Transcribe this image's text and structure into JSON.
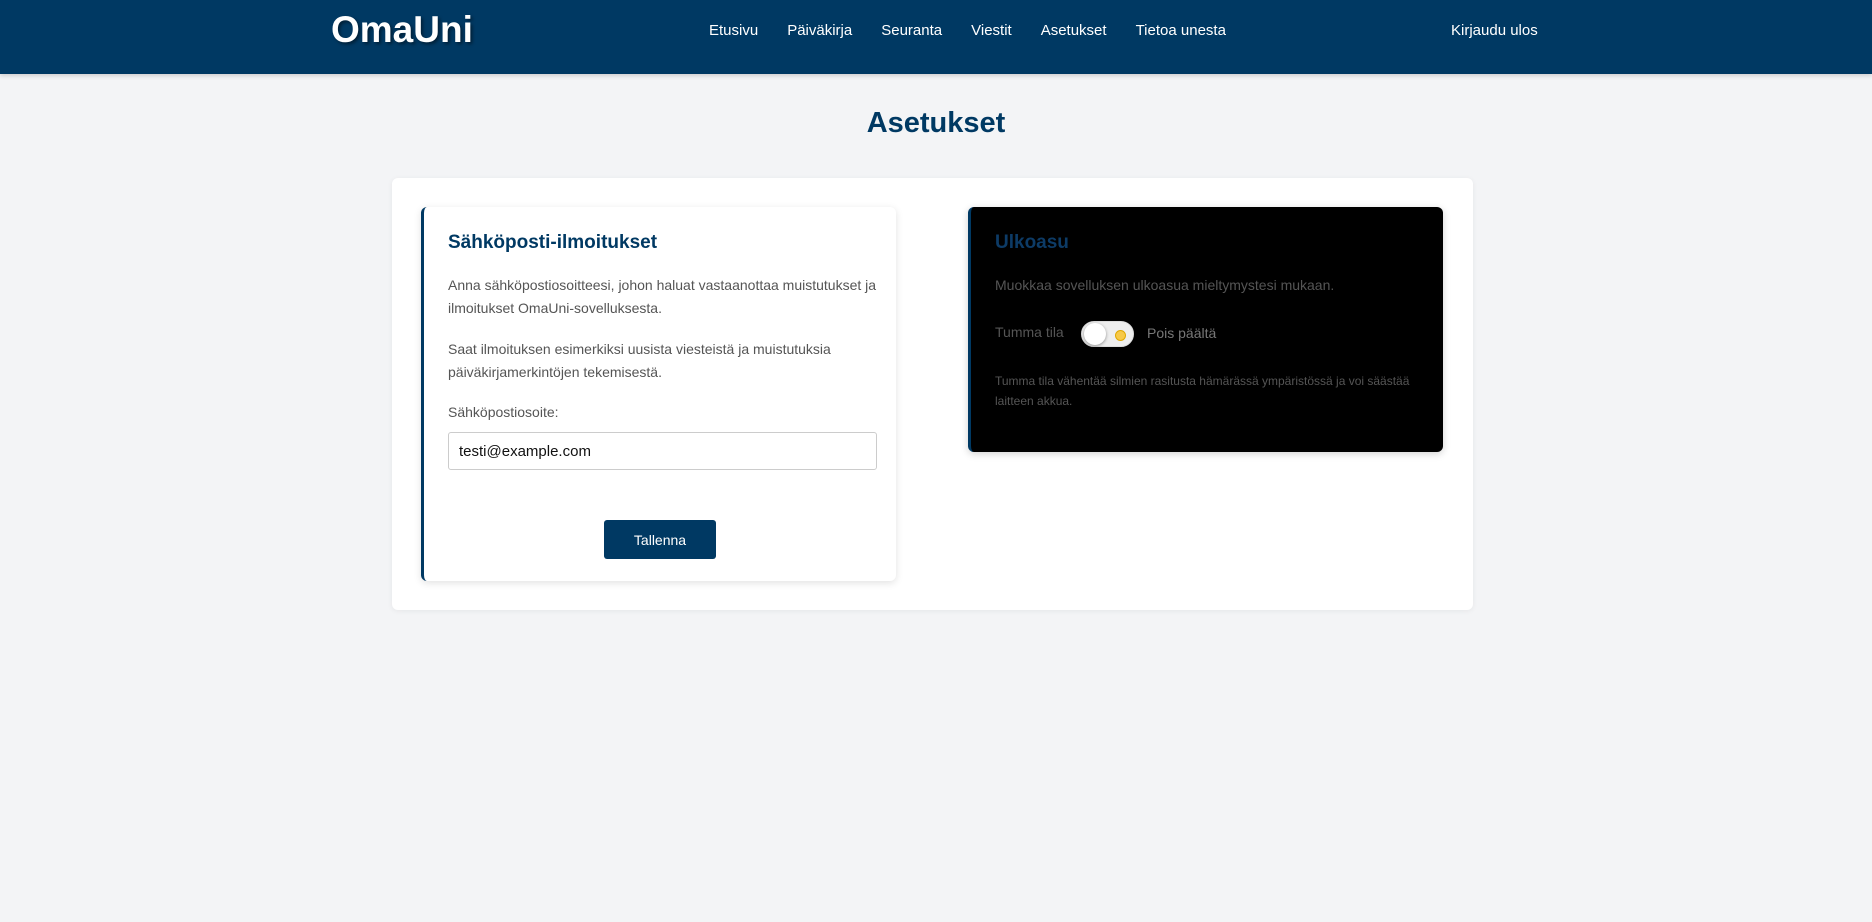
{
  "header": {
    "logo": "OmaUni",
    "nav": [
      {
        "label": "Etusivu"
      },
      {
        "label": "Päiväkirja"
      },
      {
        "label": "Seuranta"
      },
      {
        "label": "Viestit"
      },
      {
        "label": "Asetukset"
      },
      {
        "label": "Tietoa unesta"
      }
    ],
    "logout_label": "Kirjaudu ulos"
  },
  "page": {
    "title": "Asetukset"
  },
  "email_card": {
    "title": "Sähköposti-ilmoitukset",
    "paragraph1": "Anna sähköpostiosoitteesi, johon haluat vastaanottaa muistutukset ja ilmoitukset OmaUni-sovelluksesta.",
    "paragraph2": "Saat ilmoituksen esimerkiksi uusista viesteistä ja muistutuksia päiväkirjamerkintöjen tekemisestä.",
    "field_label": "Sähköpostiosoite:",
    "email_value": "testi@example.com",
    "save_label": "Tallenna"
  },
  "appearance_card": {
    "title": "Ulkoasu",
    "description": "Muokkaa sovelluksen ulkoasua mieltymystesi mukaan.",
    "dark_mode_label": "Tumma tila",
    "dark_mode_enabled": false,
    "dark_mode_state": "Pois päältä",
    "note": "Tumma tila vähentää silmien rasitusta hämärässä ympäristössä ja voi säästää laitteen akkua."
  },
  "colors": {
    "brand": "#003963",
    "background": "#f3f4f6",
    "toggle_sun": "#f7c948"
  }
}
